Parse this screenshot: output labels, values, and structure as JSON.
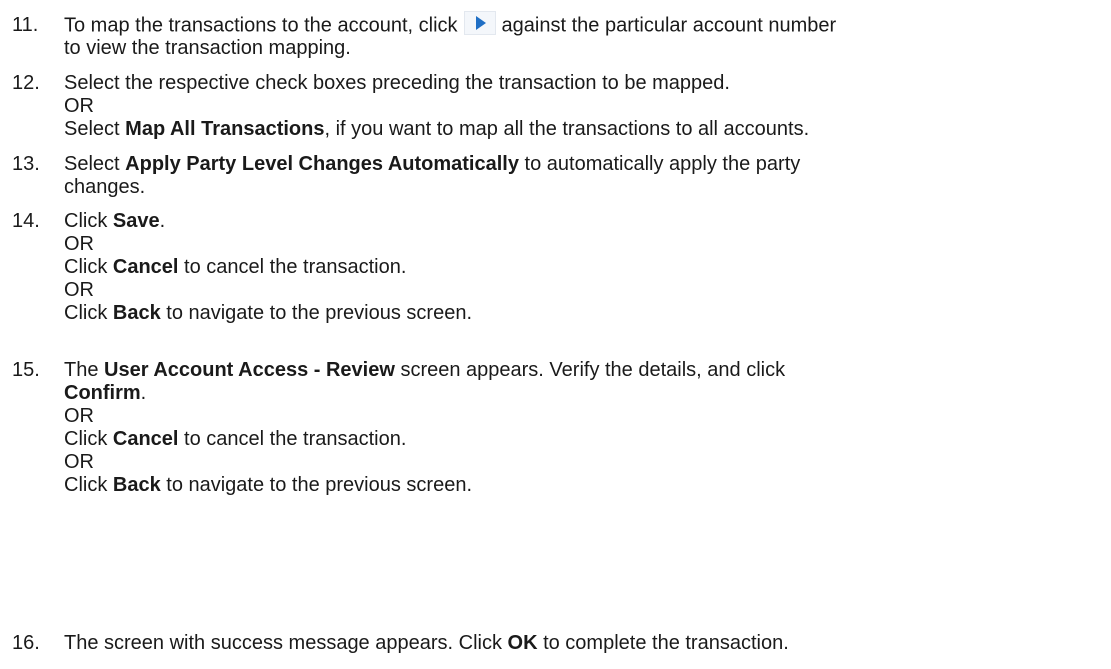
{
  "steps": [
    {
      "number": "11.",
      "line1_pre": "To map the transactions to the account, click",
      "icon": "play-arrow-icon",
      "line1_post": "against the particular account number",
      "line2": "to view the transaction mapping."
    },
    {
      "number": "12.",
      "line1": " Select the respective check boxes preceding the transaction to be mapped.",
      "or": "OR",
      "line3_pre": "Select ",
      "line3_bold": "Map All Transactions",
      "line3_post": ", if you want to map all the transactions to all accounts."
    },
    {
      "number": "13.",
      "line1_pre": "Select ",
      "line1_bold": "Apply Party Level Changes Automatically",
      "line1_post": " to automatically apply the party",
      "line2": "changes."
    },
    {
      "number": "14.",
      "save_pre": "Click ",
      "save_bold": "Save",
      "save_post": ".",
      "or1": "OR",
      "cancel_pre": "Click ",
      "cancel_bold": "Cancel",
      "cancel_post": " to cancel the transaction.",
      "or2": "OR",
      "back_pre": "Click ",
      "back_bold": "Back",
      "back_post": " to navigate to the previous screen."
    },
    {
      "number": "15.",
      "line1_pre": "The ",
      "line1_bold": "User Account Access - Review",
      "line1_post": " screen appears. Verify the details, and click",
      "confirm_bold": "Confirm",
      "confirm_post": ".",
      "or1": "OR",
      "cancel_pre": "Click ",
      "cancel_bold": "Cancel",
      "cancel_post": " to cancel the transaction.",
      "or2": "OR",
      "back_pre": "Click ",
      "back_bold": "Back",
      "back_post": " to navigate to the previous screen."
    },
    {
      "number": "16.",
      "line1_pre": "The screen with success message appears. Click ",
      "line1_bold": "OK",
      "line1_post": " to complete the transaction."
    }
  ],
  "colors": {
    "icon_arrow": "#1f6fc5",
    "text": "#1a1a1a"
  }
}
